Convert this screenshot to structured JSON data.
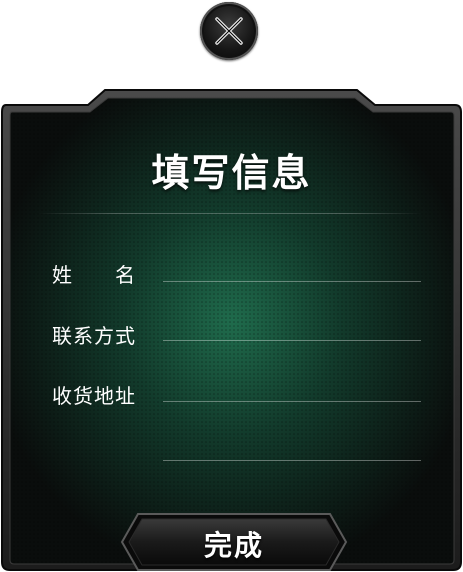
{
  "dialog": {
    "title": "填写信息",
    "fields": [
      {
        "label": "姓　　名",
        "value": "",
        "placeholder": ""
      },
      {
        "label": "联系方式",
        "value": "",
        "placeholder": ""
      },
      {
        "label": "收货地址",
        "value": "",
        "placeholder": ""
      },
      {
        "label": "",
        "value": "",
        "placeholder": ""
      }
    ],
    "submit_label": "完成"
  },
  "colors": {
    "panel_dark": "#0b0f0d",
    "panel_glow": "#1f6b4c",
    "frame": "#2a2a2a",
    "text": "#ffffff"
  },
  "icons": {
    "close": "close-x-icon"
  }
}
